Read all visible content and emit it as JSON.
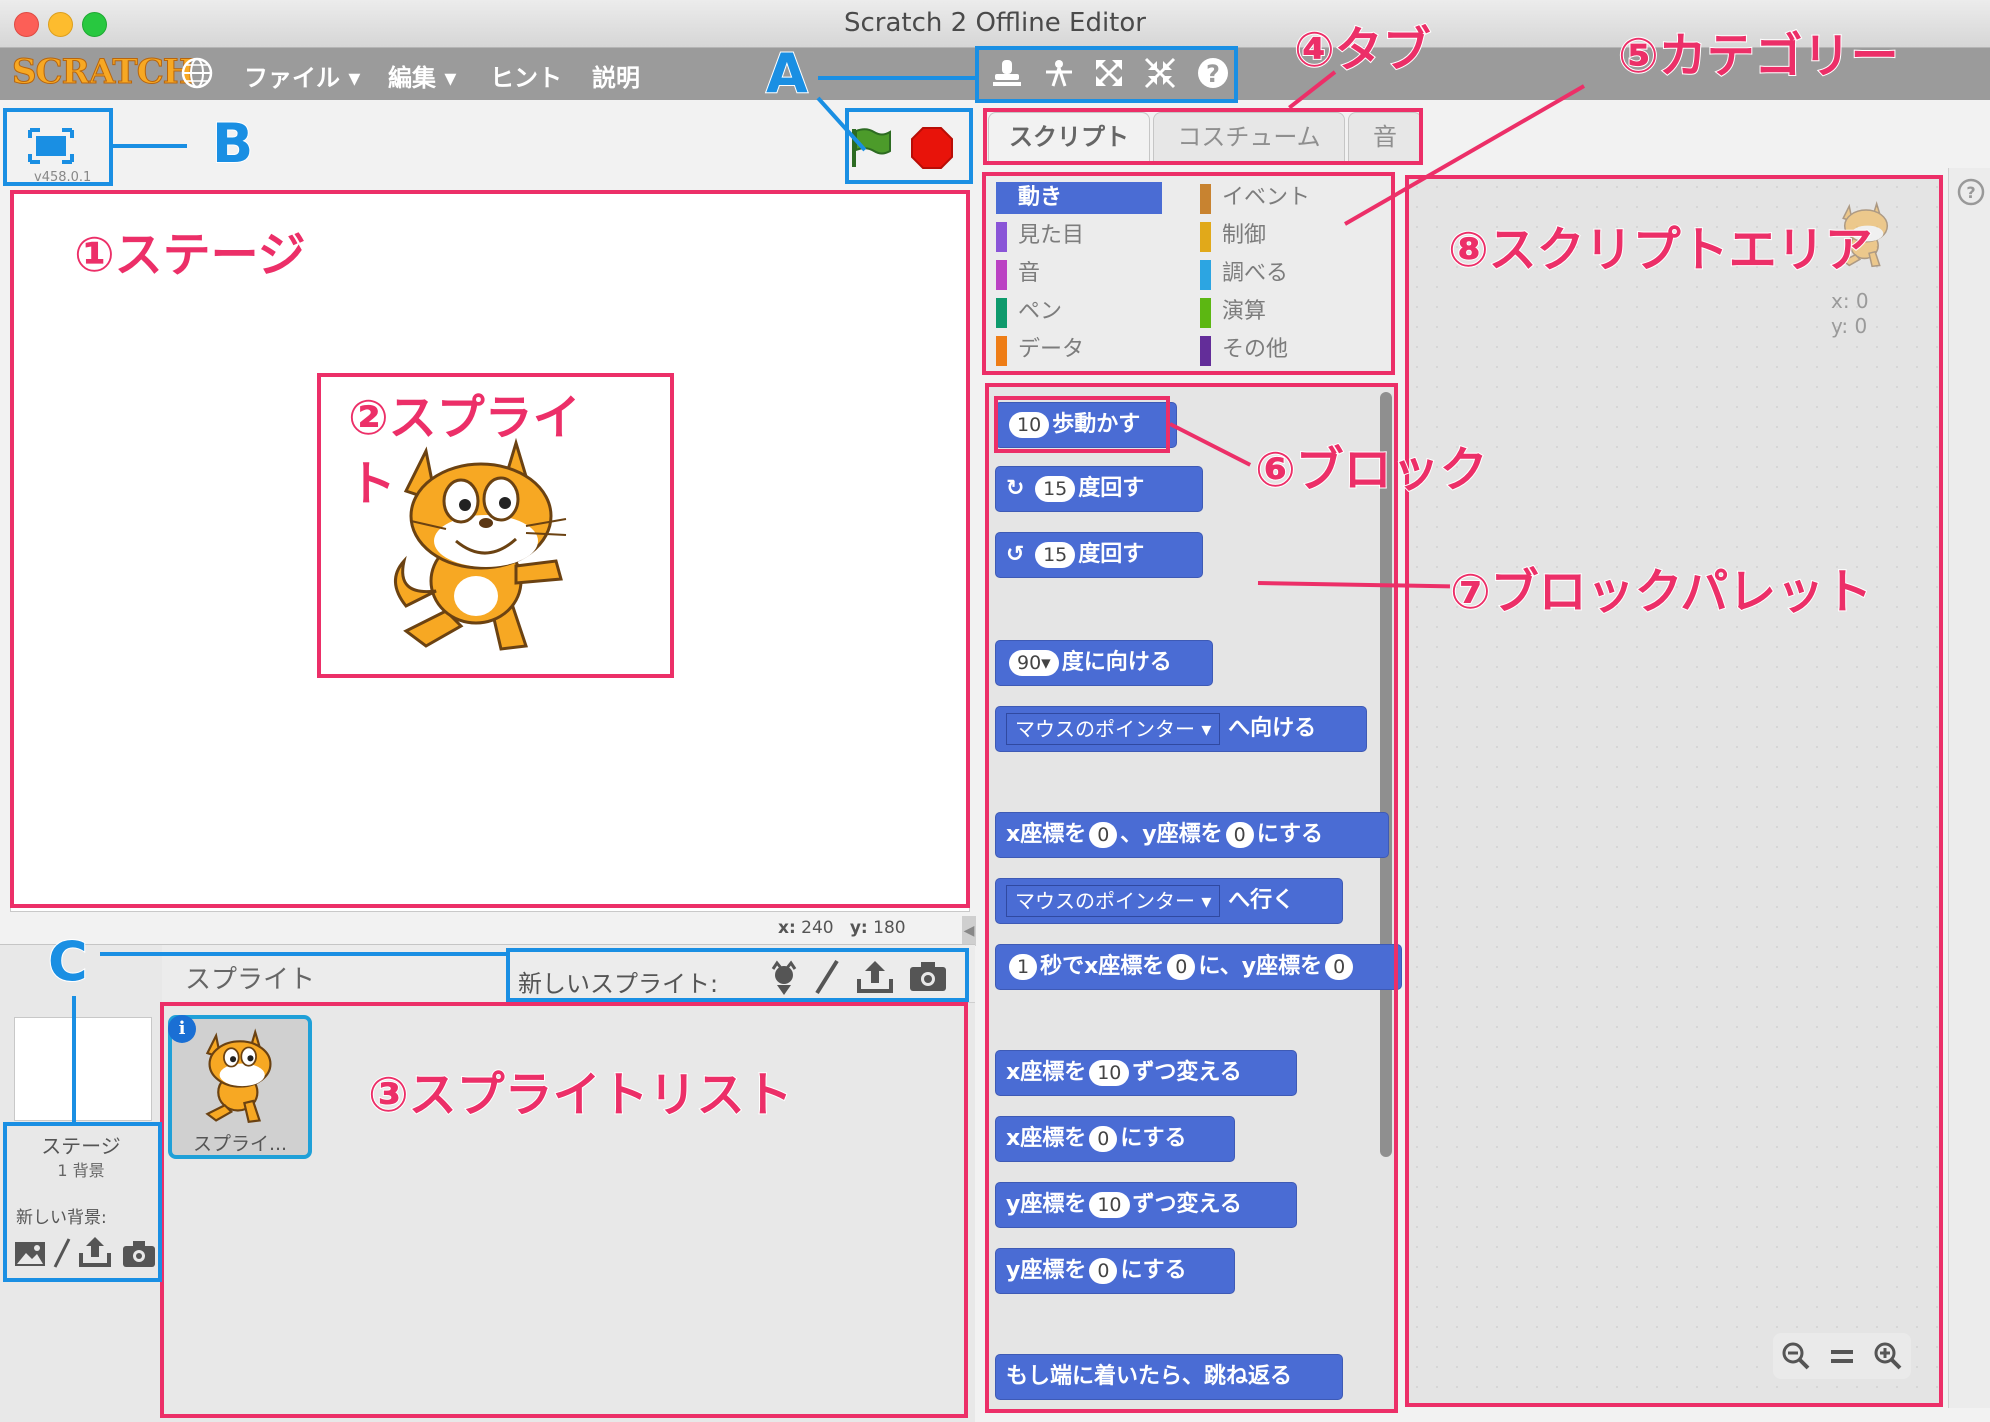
{
  "window": {
    "title": "Scratch 2 Offline Editor"
  },
  "menu": {
    "logo": "SCRATCH",
    "items": [
      "ファイル ▾",
      "編集 ▾",
      "ヒント",
      "説明"
    ]
  },
  "toolbar": {
    "tools": [
      "stamp-icon",
      "cut-icon",
      "grow-icon",
      "shrink-icon",
      "help-icon"
    ]
  },
  "stage": {
    "version": "v458.0.1",
    "coords": {
      "x_label": "x:",
      "x": "240",
      "y_label": "y:",
      "y": "180"
    }
  },
  "tabs": [
    "スクリプト",
    "コスチューム",
    "音"
  ],
  "categories": [
    {
      "label": "動き",
      "color": "#4a6cd4",
      "selected": true
    },
    {
      "label": "イベント",
      "color": "#c88330"
    },
    {
      "label": "見た目",
      "color": "#8a55d7"
    },
    {
      "label": "制御",
      "color": "#e1a91a"
    },
    {
      "label": "音",
      "color": "#bb42c3"
    },
    {
      "label": "調べる",
      "color": "#2ca5e2"
    },
    {
      "label": "ペン",
      "color": "#0e9a6c"
    },
    {
      "label": "演算",
      "color": "#5cb712"
    },
    {
      "label": "データ",
      "color": "#ee7d16"
    },
    {
      "label": "その他",
      "color": "#632d99"
    }
  ],
  "blocks": {
    "b1": {
      "num": "10",
      "text": "歩動かす"
    },
    "b2": {
      "num": "15",
      "text": "度回す"
    },
    "b3": {
      "num": "15",
      "text": "度回す"
    },
    "b4": {
      "num": "90▾",
      "text": "度に向ける"
    },
    "b5": {
      "drop": "マウスのポインター ▾",
      "text": "へ向ける"
    },
    "b6": {
      "a": "x座標を",
      "n1": "0",
      "b": "、y座標を",
      "n2": "0",
      "c": "にする"
    },
    "b7": {
      "drop": "マウスのポインター ▾",
      "text": "へ行く"
    },
    "b8": {
      "n1": "1",
      "a": "秒でx座標を",
      "n2": "0",
      "b": "に、y座標を",
      "n3": "0"
    },
    "b9": {
      "a": "x座標を",
      "n": "10",
      "b": "ずつ変える"
    },
    "b10": {
      "a": "x座標を",
      "n": "0",
      "b": "にする"
    },
    "b11": {
      "a": "y座標を",
      "n": "10",
      "b": "ずつ変える"
    },
    "b12": {
      "a": "y座標を",
      "n": "0",
      "b": "にする"
    },
    "b13": {
      "text": "もし端に着いたら、跳ね返る"
    }
  },
  "scriptarea": {
    "x": "x: 0",
    "y": "y: 0",
    "zoom": [
      "zoom-out-icon",
      "zoom-reset-icon",
      "zoom-in-icon"
    ]
  },
  "sprites": {
    "header": "スプライト",
    "new_sprite_label": "新しいスプライト:",
    "stage_label": "ステージ",
    "backdrop_count": "1 背景",
    "new_backdrop_label": "新しい背景:",
    "sprite1_name": "スプライ..."
  },
  "annotations": {
    "a1": "①ステージ",
    "a2": "②スプライト",
    "a3": "③スプライトリスト",
    "a4": "④タブ",
    "a5": "⑤カテゴリー",
    "a6": "⑥ブロック",
    "a7": "⑦ブロックパレット",
    "a8": "⑧スクリプトエリア",
    "A": "A",
    "B": "B",
    "C": "C"
  }
}
